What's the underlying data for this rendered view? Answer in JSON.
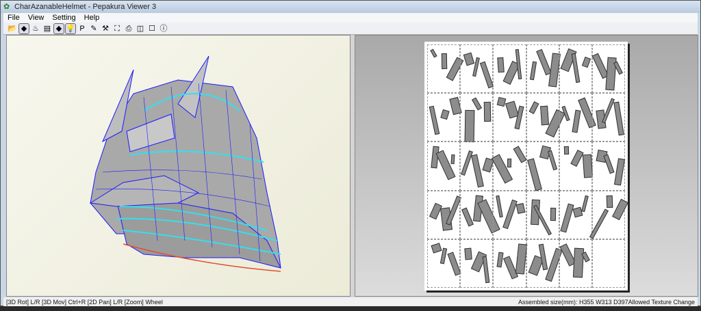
{
  "window": {
    "title": "CharAzanableHelmet - Pepakura Viewer 3"
  },
  "menu": [
    "File",
    "View",
    "Setting",
    "Help"
  ],
  "toolbar": [
    {
      "icon": "open-folder-icon",
      "glyph": "📂"
    },
    {
      "icon": "3d-view-icon",
      "glyph": "◆",
      "on": true
    },
    {
      "icon": "paint-brush-icon",
      "glyph": "♨"
    },
    {
      "icon": "texture-icon",
      "glyph": "▤"
    },
    {
      "icon": "cube-color-icon",
      "glyph": "◆",
      "on": true
    },
    {
      "icon": "light-bulb-icon",
      "glyph": "💡",
      "on": true
    },
    {
      "icon": "page-number-icon",
      "glyph": "P"
    },
    {
      "icon": "edge-icon",
      "glyph": "✎"
    },
    {
      "icon": "tool-icon",
      "glyph": "⚒"
    },
    {
      "icon": "select-icon",
      "glyph": "⛶"
    },
    {
      "icon": "print-icon",
      "glyph": "⎙"
    },
    {
      "icon": "split-view-icon",
      "glyph": "◫"
    },
    {
      "icon": "single-view-icon",
      "glyph": "☐"
    },
    {
      "icon": "info-icon",
      "glyph": "ⓘ"
    }
  ],
  "status": {
    "left": "[3D Rot] L/R [3D Mov] Ctrl+R [2D Pan] L/R [Zoom] Wheel",
    "right": "Assembled size(mm): H355 W313 D397Allowed Texture Change"
  },
  "colors": {
    "accent": "#1a1aff",
    "seam": "#33e0f0"
  }
}
